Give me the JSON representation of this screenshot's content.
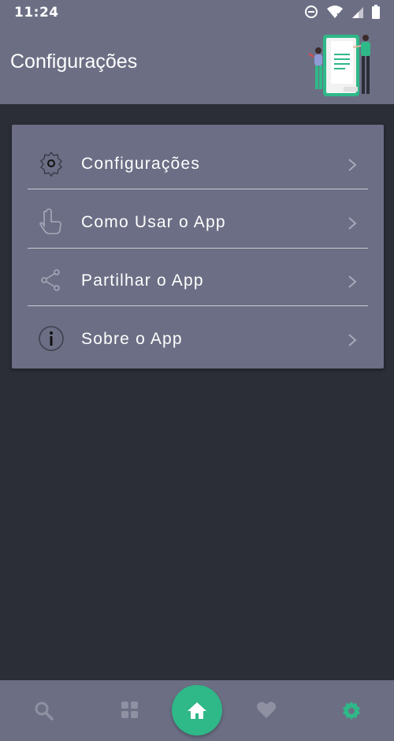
{
  "status_bar": {
    "time": "11:24",
    "icons": [
      "do-not-disturb-icon",
      "wifi-icon",
      "signal-icon",
      "battery-icon"
    ]
  },
  "header": {
    "title": "Configurações",
    "illustration": "people-with-document-illustration"
  },
  "menu": {
    "items": [
      {
        "label": "Configurações",
        "icon": "gear-icon"
      },
      {
        "label": "Como Usar o App",
        "icon": "tap-hand-icon"
      },
      {
        "label": "Partilhar o App",
        "icon": "share-icon"
      },
      {
        "label": "Sobre o App",
        "icon": "info-icon"
      }
    ]
  },
  "bottom_nav": {
    "items": [
      "search-icon",
      "grid-icon",
      "home-icon",
      "heart-icon",
      "settings-icon"
    ],
    "active": "settings-icon"
  },
  "colors": {
    "header_bg": "#6c6f84",
    "body_bg": "#2b2d37",
    "accent": "#2fb888"
  }
}
